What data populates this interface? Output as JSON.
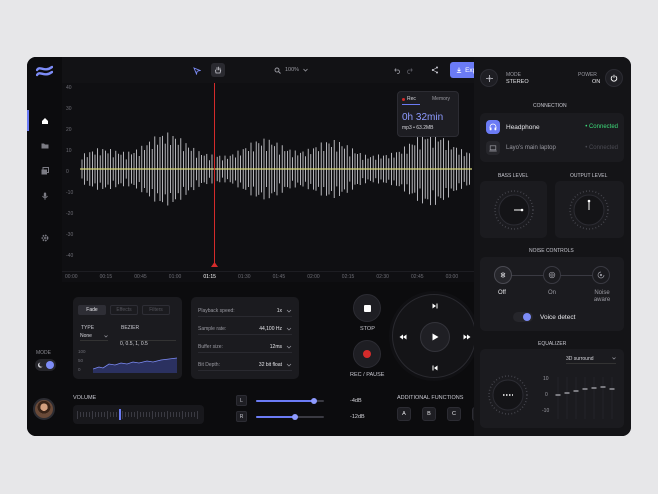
{
  "toolbar": {
    "zoom": "100%",
    "export_label": "Export"
  },
  "sidebar": {
    "items": [
      {
        "name": "home",
        "active": true
      },
      {
        "name": "folder",
        "active": false
      },
      {
        "name": "library",
        "active": false
      },
      {
        "name": "mic",
        "active": false
      },
      {
        "name": "settings",
        "active": false
      }
    ],
    "mode_label": "MODE"
  },
  "waveform": {
    "y_ticks": [
      "40",
      "30",
      "20",
      "10",
      "0",
      "-10",
      "-20",
      "-30",
      "-40"
    ],
    "time_ticks": [
      "00:00",
      "00:15",
      "00:45",
      "01:00",
      "01:15",
      "01:30",
      "01:45",
      "02:00",
      "02:15",
      "02:30",
      "02:45",
      "03:00"
    ],
    "active_time": "01:15",
    "rec_card": {
      "tab_rec": "Rec",
      "tab_memory": "Memory",
      "duration": "0h 32min",
      "info": "mp3 • 63.2MB"
    }
  },
  "fade_panel": {
    "tabs": [
      "Fade",
      "Effects",
      "Filters"
    ],
    "type_label": "TYPE",
    "type_value": "None",
    "bezier_label": "BEZIER",
    "bezier_value": "0, 0.5, 1, 0.5",
    "graph_ticks": [
      "100",
      "50",
      "0"
    ]
  },
  "settings": [
    {
      "label": "Playback speed:",
      "value": "1x"
    },
    {
      "label": "Sample rate:",
      "value": "44,100 Hz"
    },
    {
      "label": "Buffer size:",
      "value": "12ms"
    },
    {
      "label": "Bit Depth:",
      "value": "32 bit float"
    }
  ],
  "transport": {
    "stop_label": "STOP",
    "rec_label": "REC / PAUSE"
  },
  "volume": {
    "label": "VOLUME",
    "left_label": "L",
    "right_label": "R",
    "left_db": "-4dB",
    "right_db": "-12dB",
    "left_level": 0.85,
    "right_level": 0.58
  },
  "additional": {
    "label": "ADDITIONAL FUNCTIONS",
    "buttons": [
      "A",
      "B",
      "C",
      "D"
    ]
  },
  "right_panel": {
    "mode_label": "MODE",
    "mode_value": "STEREO",
    "power_label": "POWER",
    "power_value": "ON",
    "connection_title": "CONNECTION",
    "devices": [
      {
        "name": "Headphone",
        "status": "• Connected",
        "active": true
      },
      {
        "name": "Layo's main laptop",
        "status": "• Connected",
        "active": false
      }
    ],
    "bass_label": "BASS LEVEL",
    "output_label": "OUTPUT LEVEL",
    "noise_title": "NOISE CONTROLS",
    "noise_options": [
      "Off",
      "On",
      "Noise aware"
    ],
    "voice_detect_label": "Voice detect",
    "equalizer_title": "EQUALIZER",
    "eq_preset": "3D surround",
    "eq_ticks": [
      "10",
      "0",
      "-10"
    ]
  },
  "colors": {
    "accent": "#6b7bf5",
    "wave": "#d8d67a",
    "playhead": "#d42b2b",
    "connected": "#3ddc7a",
    "record": "#d42b2b"
  }
}
